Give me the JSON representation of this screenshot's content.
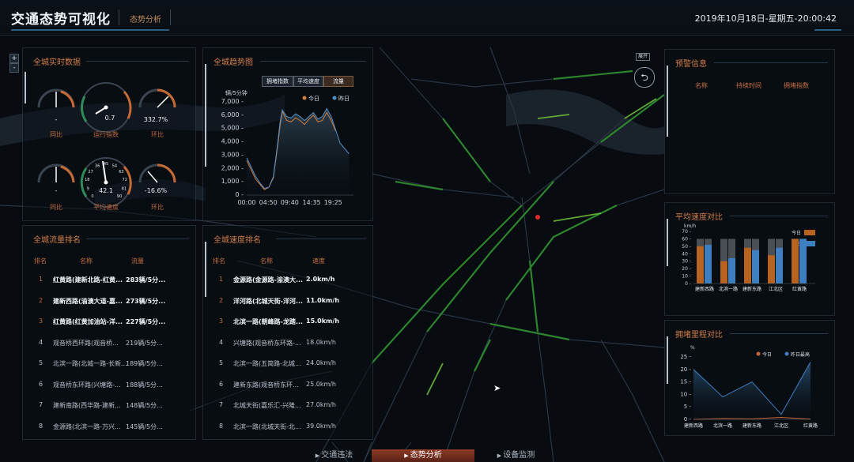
{
  "header": {
    "title": "交通态势可视化",
    "active_tab": "态势分析",
    "datetime": "2019年10月18日-星期五-20:00:42"
  },
  "map_controls": {
    "zoom_in": "+",
    "zoom_out": "-",
    "expand": "展开"
  },
  "realtime": {
    "title": "全城实时数据",
    "gauges": [
      {
        "label": "同比",
        "value": "-"
      },
      {
        "label": "运行指数",
        "value": "0.7"
      },
      {
        "label": "环比",
        "value": "332.7%"
      },
      {
        "label": "同比",
        "value": "-"
      },
      {
        "label": "平均速度",
        "value": "42.1"
      },
      {
        "label": "环比",
        "value": "-16.6%"
      }
    ],
    "speed_ticks": [
      "0",
      "9",
      "18",
      "27",
      "36",
      "45",
      "54",
      "63",
      "72",
      "81",
      "90"
    ]
  },
  "trend": {
    "title": "全城趋势图",
    "buttons": [
      "拥堵指数",
      "平均速度",
      "流量"
    ],
    "active_button": "流量",
    "legend": [
      {
        "name": "今日",
        "color": "#d27d3a"
      },
      {
        "name": "昨日",
        "color": "#4f8fc8"
      }
    ]
  },
  "chart_data": [
    {
      "type": "line",
      "ylabel": "辆/5分钟",
      "ylim": [
        0,
        7000
      ],
      "y_ticks": [
        "7,000",
        "6,000",
        "5,000",
        "4,000",
        "3,000",
        "2,000",
        "1,000",
        "0"
      ],
      "x_ticks": [
        "00:00",
        "04:50",
        "09:40",
        "14:35",
        "19:25"
      ],
      "series": [
        {
          "name": "今日",
          "x": [
            "00:00",
            "01:00",
            "02:00",
            "03:00",
            "04:00",
            "05:00",
            "06:00",
            "07:00",
            "07:30",
            "08:00",
            "09:00",
            "10:00",
            "11:00",
            "12:00",
            "13:00",
            "14:00",
            "15:00",
            "16:00",
            "17:00",
            "18:00",
            "19:00",
            "20:00"
          ],
          "values": [
            2600,
            1900,
            1200,
            800,
            400,
            600,
            1300,
            3800,
            5200,
            6300,
            5600,
            5500,
            5800,
            5600,
            5300,
            5700,
            6000,
            5500,
            5600,
            6200,
            5600,
            4800
          ]
        },
        {
          "name": "昨日",
          "x": [
            "00:00",
            "01:00",
            "02:00",
            "03:00",
            "04:00",
            "05:00",
            "06:00",
            "07:00",
            "07:30",
            "08:00",
            "09:00",
            "10:00",
            "11:00",
            "12:00",
            "13:00",
            "14:00",
            "15:00",
            "16:00",
            "17:00",
            "18:00",
            "19:00",
            "20:00",
            "21:00",
            "22:00",
            "23:00"
          ],
          "values": [
            2800,
            2100,
            1400,
            900,
            500,
            600,
            1400,
            4000,
            5500,
            6400,
            5900,
            5800,
            6100,
            5900,
            5600,
            5900,
            6200,
            5700,
            5900,
            6500,
            5900,
            4900,
            3900,
            3500,
            3100
          ]
        }
      ]
    },
    {
      "type": "bar",
      "title": "平均速度对比",
      "ylabel": "km/h",
      "ylim": [
        0,
        70
      ],
      "y_ticks": [
        "70",
        "60",
        "50",
        "40",
        "30",
        "20",
        "10",
        "0"
      ],
      "categories": [
        "建新西路",
        "北滨一路",
        "建新东路",
        "江北区",
        "红黄路"
      ],
      "series": [
        {
          "name": "今日",
          "color": "#b8631f",
          "values": [
            50,
            30,
            48,
            38,
            60
          ]
        },
        {
          "name": "昨日",
          "color": "#3d7fc0",
          "values": [
            52,
            34,
            45,
            48,
            60
          ]
        }
      ]
    },
    {
      "type": "area",
      "title": "拥堵里程对比",
      "ylabel": "%",
      "ylim": [
        0,
        25
      ],
      "y_ticks": [
        "25",
        "20",
        "15",
        "10",
        "5",
        "0"
      ],
      "categories": [
        "建新西路",
        "北滨一路",
        "建新东路",
        "江北区",
        "红黄路"
      ],
      "series": [
        {
          "name": "今日",
          "color": "#c9653a",
          "values": [
            0,
            0.3,
            0.2,
            0.8,
            0.1
          ]
        },
        {
          "name": "昨日最高",
          "color": "#3d7fc0",
          "values": [
            20,
            9,
            15,
            2,
            23
          ]
        }
      ]
    }
  ],
  "flow_rank": {
    "title": "全城流量排名",
    "headers": [
      "排名",
      "名称",
      "流量"
    ],
    "rows": [
      {
        "rank": "1",
        "name": "红黄路(建新北路-红黄...",
        "value": "283辆/5分..."
      },
      {
        "rank": "2",
        "name": "建新西路(渝澳大道-嘉...",
        "value": "273辆/5分..."
      },
      {
        "rank": "3",
        "name": "红黄路(红黄加油站-洋...",
        "value": "227辆/5分..."
      },
      {
        "rank": "4",
        "name": "观音桥西环路(观音桥...",
        "value": "219辆/5分..."
      },
      {
        "rank": "5",
        "name": "北滨一路(北城一路-长新...",
        "value": "189辆/5分..."
      },
      {
        "rank": "6",
        "name": "观音桥东环路(兴塘路-...",
        "value": "188辆/5分..."
      },
      {
        "rank": "7",
        "name": "建新南路(西华路-建新...",
        "value": "148辆/5分..."
      },
      {
        "rank": "8",
        "name": "金源路(北滨一路-万兴...",
        "value": "145辆/5分..."
      }
    ]
  },
  "speed_rank": {
    "title": "全城速度排名",
    "headers": [
      "排名",
      "名称",
      "速度"
    ],
    "rows": [
      {
        "rank": "1",
        "name": "金源路(金源路-渝澳大...",
        "value": "2.0km/h"
      },
      {
        "rank": "2",
        "name": "洋河路(北城天街-洋河...",
        "value": "11.0km/h"
      },
      {
        "rank": "3",
        "name": "北滨一路(朝峰路-龙踏...",
        "value": "15.0km/h"
      },
      {
        "rank": "4",
        "name": "兴塘路(观音桥东环路-...",
        "value": "18.0km/h"
      },
      {
        "rank": "5",
        "name": "北滨一路(五简路-北城...",
        "value": "24.0km/h"
      },
      {
        "rank": "6",
        "name": "建新东路(观音桥东环...",
        "value": "25.0km/h"
      },
      {
        "rank": "7",
        "name": "北城天街(嘉乐汇-兴隆...",
        "value": "27.0km/h"
      },
      {
        "rank": "8",
        "name": "北滨一路(北城天街-北...",
        "value": "39.0km/h"
      }
    ]
  },
  "warning": {
    "title": "预警信息",
    "headers": [
      "名称",
      "持续时间",
      "拥堵指数"
    ]
  },
  "bottom_nav": {
    "tabs": [
      "交通违法",
      "态势分析",
      "设备监测"
    ],
    "active": "态势分析"
  }
}
